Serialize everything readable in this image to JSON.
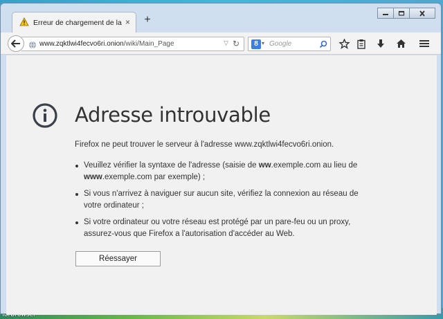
{
  "tab": {
    "title": "Erreur de chargement de la...",
    "close": "×",
    "new_tab": "+"
  },
  "window_controls": [
    "minimize-icon",
    "restore-icon",
    "close-icon"
  ],
  "navbar": {
    "url_domain": "www.zqktlwi4fecvo6ri.onion",
    "url_path": "/wiki/Main_Page",
    "search_placeholder": "Google",
    "search_engine_letter": "8"
  },
  "error": {
    "title": "Adresse introuvable",
    "description": "Firefox ne peut trouver le serveur à l'adresse www.zqktlwi4fecvo6ri.onion.",
    "bullet1_a": "Veuillez vérifier la syntaxe de l'adresse (saisie de ",
    "bullet1_b1": "ww",
    "bullet1_c": ".exemple.com au lieu de ",
    "bullet1_b2": "www",
    "bullet1_d": ".exemple.com par exemple) ;",
    "bullet2": "Si vous n'arrivez à naviguer sur aucun site, vérifiez la connexion au réseau de votre ordinateur ;",
    "bullet3": "Si votre ordinateur ou votre réseau est protégé par un pare-feu ou un proxy, assurez-vous que Firefox a l'autorisation d'accéder au Web.",
    "retry_label": "Réessayer"
  },
  "desktop": {
    "label": "TorBrowser"
  },
  "colors": {
    "content_bg": "#f1f1f1",
    "text": "#333333",
    "icon": "#3a3f4a",
    "window_frame": "#cfdff0"
  }
}
